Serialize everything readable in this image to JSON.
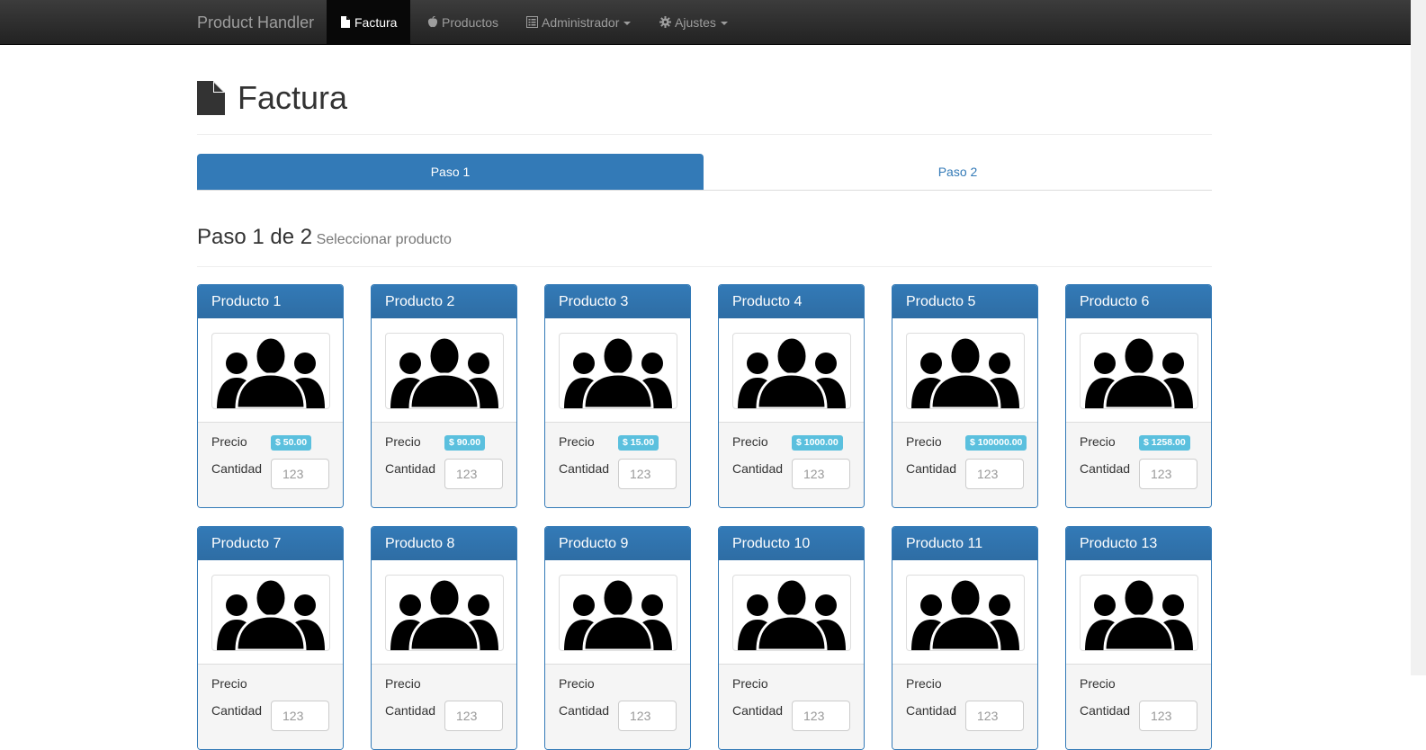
{
  "navbar": {
    "brand": "Product Handler",
    "items": [
      {
        "label": "Factura",
        "icon": "file-icon",
        "active": true
      },
      {
        "label": "Productos",
        "icon": "apple-icon"
      },
      {
        "label": "Administrador",
        "icon": "list-alt-icon",
        "dropdown": true
      },
      {
        "label": "Ajustes",
        "icon": "cog-icon",
        "dropdown": true
      }
    ]
  },
  "page": {
    "title": "Factura",
    "title_icon": "file-icon"
  },
  "steps": [
    {
      "label": "Paso 1",
      "active": true
    },
    {
      "label": "Paso 2",
      "active": false
    }
  ],
  "section": {
    "title": "Paso 1 de 2",
    "subtitle": "Seleccionar producto"
  },
  "labels": {
    "price": "Precio",
    "quantity": "Cantidad",
    "quantity_placeholder": "123"
  },
  "products": [
    {
      "name": "Producto 1",
      "price": "$ 50.00"
    },
    {
      "name": "Producto 2",
      "price": "$ 90.00"
    },
    {
      "name": "Producto 3",
      "price": "$ 15.00"
    },
    {
      "name": "Producto 4",
      "price": "$ 1000.00"
    },
    {
      "name": "Producto 5",
      "price": "$ 100000.00"
    },
    {
      "name": "Producto 6",
      "price": "$ 1258.00"
    },
    {
      "name": "Producto 7",
      "price": ""
    },
    {
      "name": "Producto 8",
      "price": ""
    },
    {
      "name": "Producto 9",
      "price": ""
    },
    {
      "name": "Producto 10",
      "price": ""
    },
    {
      "name": "Producto 11",
      "price": ""
    },
    {
      "name": "Producto 13",
      "price": ""
    }
  ],
  "colors": {
    "primary": "#337ab7",
    "navbar": "#222222",
    "badge": "#5bc0de"
  }
}
